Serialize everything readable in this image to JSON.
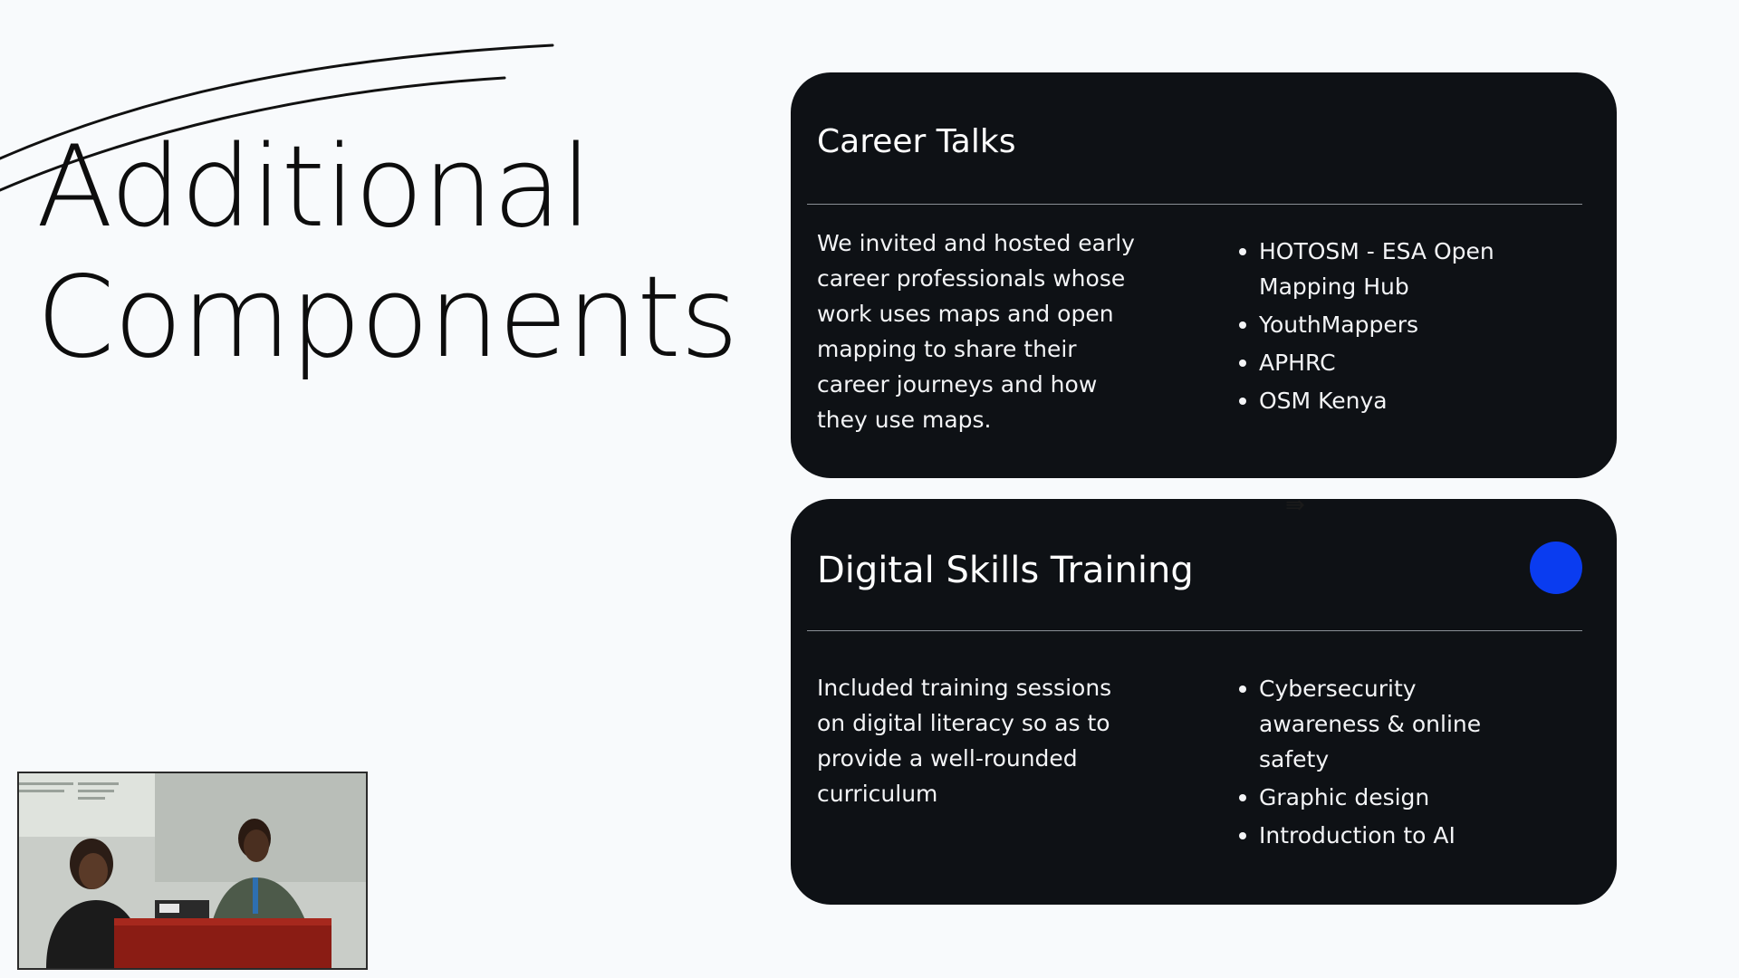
{
  "slide": {
    "title_line1": "Additional",
    "title_line2": "Components"
  },
  "cards": [
    {
      "title": "Career Talks",
      "description": "We invited and hosted early career professionals whose work uses maps and open mapping to share their career journeys and how they use maps.",
      "bullets": [
        "HOTOSM - ESA Open Mapping Hub",
        "YouthMappers",
        "APHRC",
        "OSM Kenya"
      ]
    },
    {
      "title": "Digital Skills Training",
      "description": "Included training sessions on digital literacy so as to provide a well-rounded curriculum",
      "bullets": [
        "Cybersecurity awareness & online safety",
        "Graphic design",
        "Introduction to AI"
      ],
      "accent_dot_color": "#0a3cf0"
    }
  ],
  "colors": {
    "background": "#f8fafc",
    "card_background": "#0e1115",
    "accent_blue": "#0a3cf0"
  },
  "icons": {
    "cursor": "move-cursor-icon",
    "swoosh": "decorative-swoosh"
  }
}
